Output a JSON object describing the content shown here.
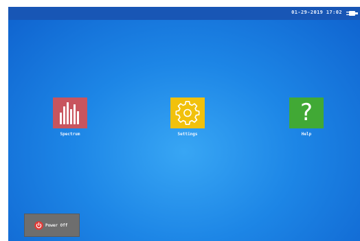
{
  "status_bar": {
    "datetime": "01-29-2019 17:02",
    "icon": "power-plug-icon"
  },
  "apps": [
    {
      "label": "Spectrum",
      "icon": "spectrum-bars-icon",
      "color": "#c8555e"
    },
    {
      "label": "Settings",
      "icon": "gear-icon",
      "color": "#f1c10c"
    },
    {
      "label": "Help",
      "icon": "question-mark-icon",
      "color": "#41a935",
      "glyph": "?"
    }
  ],
  "power_button": {
    "label": "Power Off",
    "icon": "power-icon"
  }
}
